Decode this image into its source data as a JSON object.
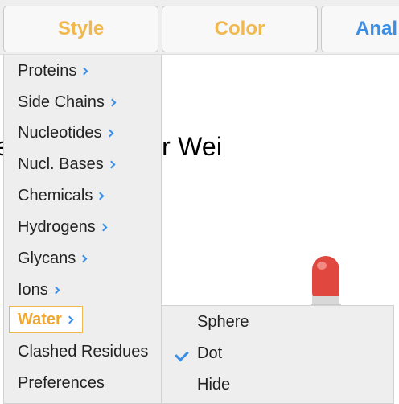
{
  "menubar": {
    "style": "Style",
    "color": "Color",
    "analysis": "Anal"
  },
  "canvas": {
    "title_text": "e            ow Molecular Wei"
  },
  "style_menu": {
    "items": [
      {
        "label": "Proteins",
        "submenu": true
      },
      {
        "label": "Side Chains",
        "submenu": true
      },
      {
        "label": "Nucleotides",
        "submenu": true
      },
      {
        "label": "Nucl. Bases",
        "submenu": true
      },
      {
        "label": "Chemicals",
        "submenu": true
      },
      {
        "label": "Hydrogens",
        "submenu": true
      },
      {
        "label": "Glycans",
        "submenu": true
      },
      {
        "label": "Ions",
        "submenu": true
      },
      {
        "label": "Water",
        "submenu": true,
        "active": true
      },
      {
        "label": "Clashed Residues",
        "submenu": false
      },
      {
        "label": "Preferences",
        "submenu": false
      }
    ]
  },
  "water_submenu": {
    "items": [
      {
        "label": "Sphere",
        "checked": false
      },
      {
        "label": "Dot",
        "checked": true
      },
      {
        "label": "Hide",
        "checked": false
      }
    ]
  },
  "colors": {
    "style_tab": "#f0b84e",
    "color_tab": "#f0b84e",
    "analysis_tab": "#3a8ee6",
    "chevron": "#3a8ee6",
    "molecule_red": "#e0473f"
  },
  "icons": [
    "chevron-right-icon",
    "checkmark-icon"
  ]
}
